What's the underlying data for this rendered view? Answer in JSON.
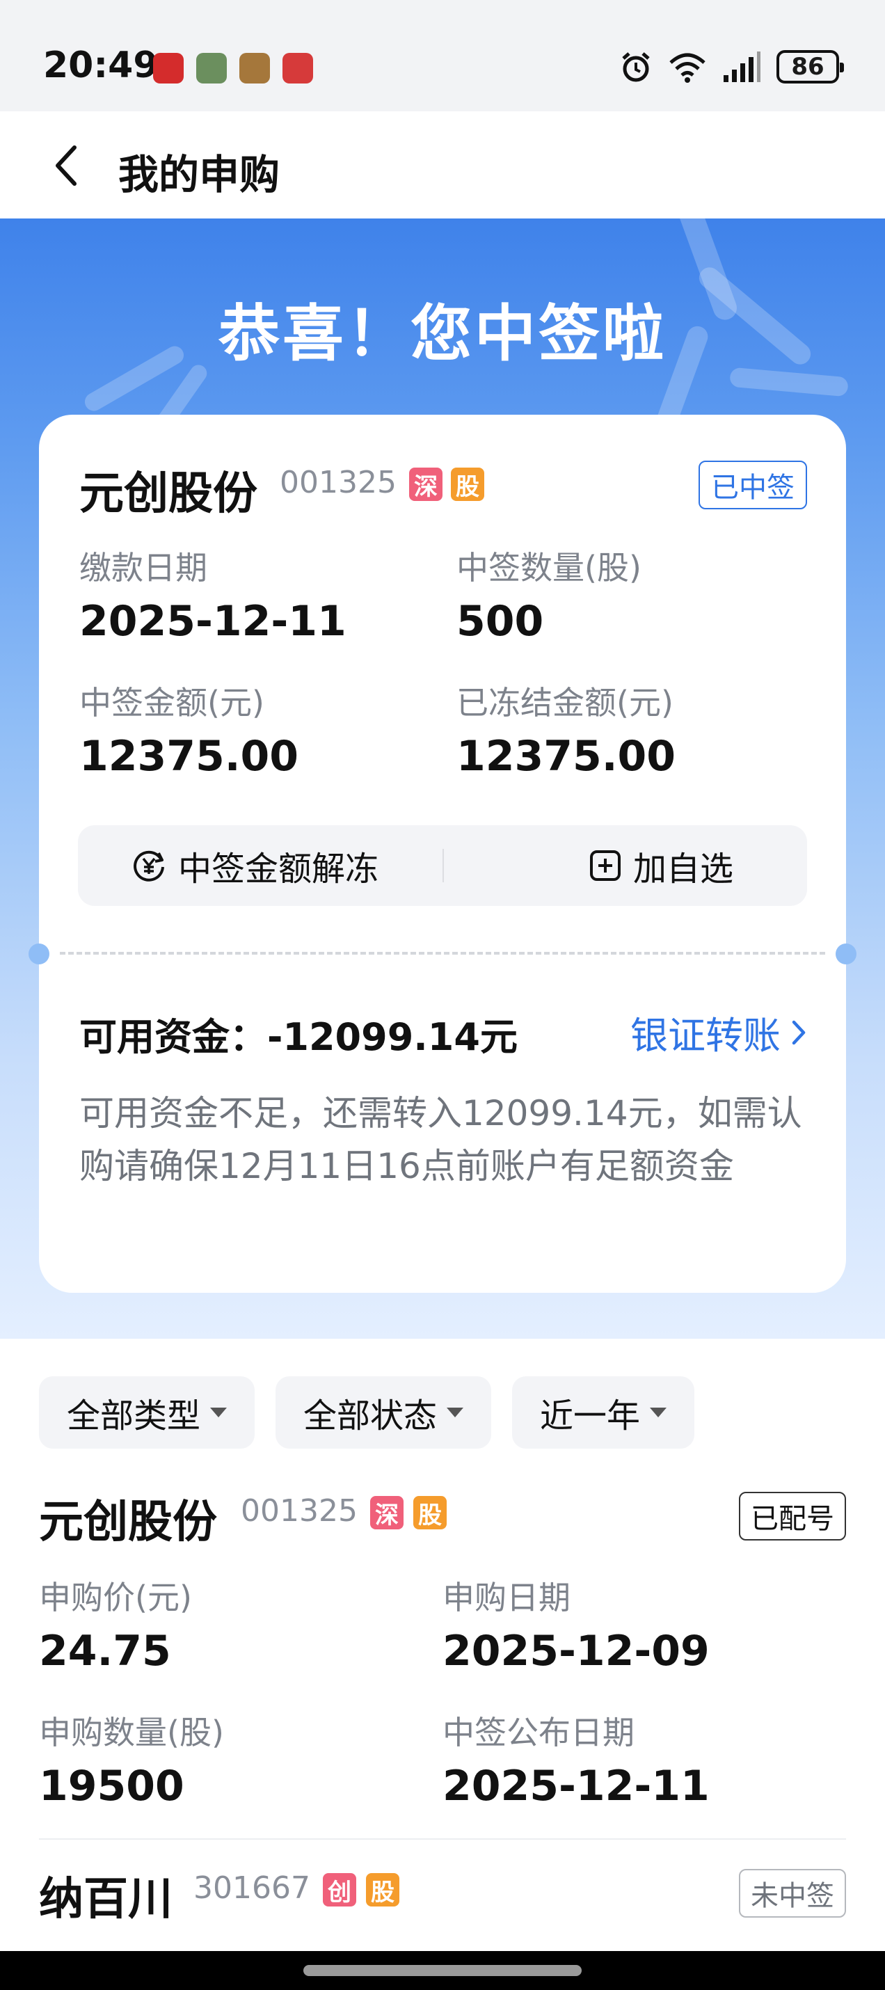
{
  "status_bar": {
    "time": "20:49",
    "battery": "86",
    "icons": [
      "alarm-icon",
      "wifi-icon",
      "signal-icon",
      "battery-icon"
    ],
    "app_icon_colors": [
      "#d42c2c",
      "#6b8f5e",
      "#a5773b",
      "#d63a3a"
    ]
  },
  "navbar": {
    "title": "我的申购",
    "back_icon": "chevron-left-icon"
  },
  "hero": {
    "title": "恭喜！您中签啦"
  },
  "win_card": {
    "name": "元创股份",
    "code": "001325",
    "tag1": "深",
    "tag2": "股",
    "status": "已中签",
    "fields": [
      {
        "label": "缴款日期",
        "value": "2025-12-11"
      },
      {
        "label": "中签数量(股)",
        "value": "500"
      },
      {
        "label": "中签金额(元)",
        "value": "12375.00"
      },
      {
        "label": "已冻结金额(元)",
        "value": "12375.00"
      }
    ],
    "actions": {
      "unfreeze_label": "中签金额解冻",
      "add_watch_label": "加自选"
    },
    "available_funds": "可用资金：-12099.14元",
    "transfer_label": "银证转账",
    "notice": "可用资金不足，还需转入12099.14元，如需认购请确保12月11日16点前账户有足额资金"
  },
  "filters": [
    "全部类型",
    "全部状态",
    "近一年"
  ],
  "records": [
    {
      "name": "元创股份",
      "code": "001325",
      "tag1": "深",
      "tag2": "股",
      "status": "已配号",
      "fields": [
        {
          "label": "申购价(元)",
          "value": "24.75"
        },
        {
          "label": "申购日期",
          "value": "2025-12-09"
        },
        {
          "label": "申购数量(股)",
          "value": "19500"
        },
        {
          "label": "中签公布日期",
          "value": "2025-12-11"
        }
      ]
    },
    {
      "name": "纳百川",
      "code": "301667",
      "tag1": "创",
      "tag2": "股",
      "status": "未中签"
    }
  ],
  "colors": {
    "accent_blue": "#2f74e4",
    "tag_red": "#f0607a",
    "tag_orange": "#f59c2c"
  }
}
